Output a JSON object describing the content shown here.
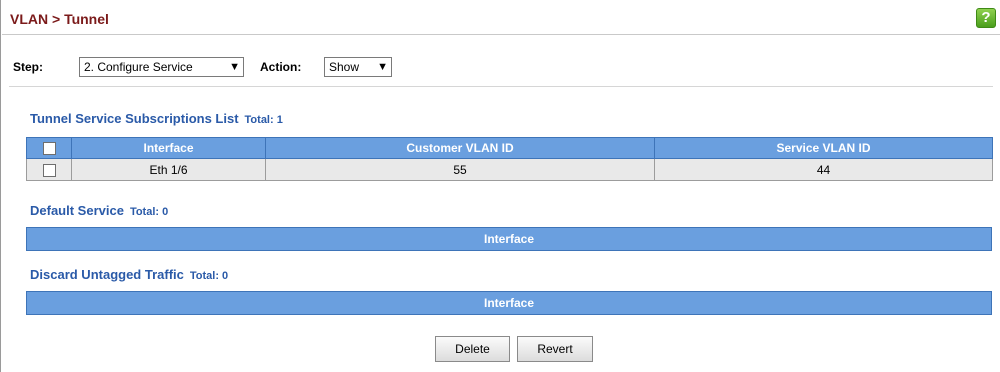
{
  "header": {
    "title": "VLAN > Tunnel",
    "help_glyph": "?"
  },
  "toolbar": {
    "step_label": "Step:",
    "step_value": "2. Configure Service",
    "action_label": "Action:",
    "action_value": "Show",
    "dropdown_glyph": "▼"
  },
  "subscriptions": {
    "title": "Tunnel Service Subscriptions List",
    "total": "Total: 1",
    "columns": [
      "Interface",
      "Customer VLAN ID",
      "Service VLAN ID"
    ],
    "rows": [
      {
        "interface": "Eth 1/6",
        "customer_vlan": "55",
        "service_vlan": "44"
      }
    ]
  },
  "default_service": {
    "title": "Default Service",
    "total": "Total: 0",
    "column": "Interface"
  },
  "discard_untagged": {
    "title": "Discard Untagged Traffic",
    "total": "Total: 0",
    "column": "Interface"
  },
  "buttons": {
    "delete": "Delete",
    "revert": "Revert"
  },
  "colors": {
    "title": "#7b1a1a",
    "section": "#2a5aa8",
    "header_bg": "#6a9fdf",
    "row_bg": "#e9e9e9",
    "help": "#5aae22"
  }
}
